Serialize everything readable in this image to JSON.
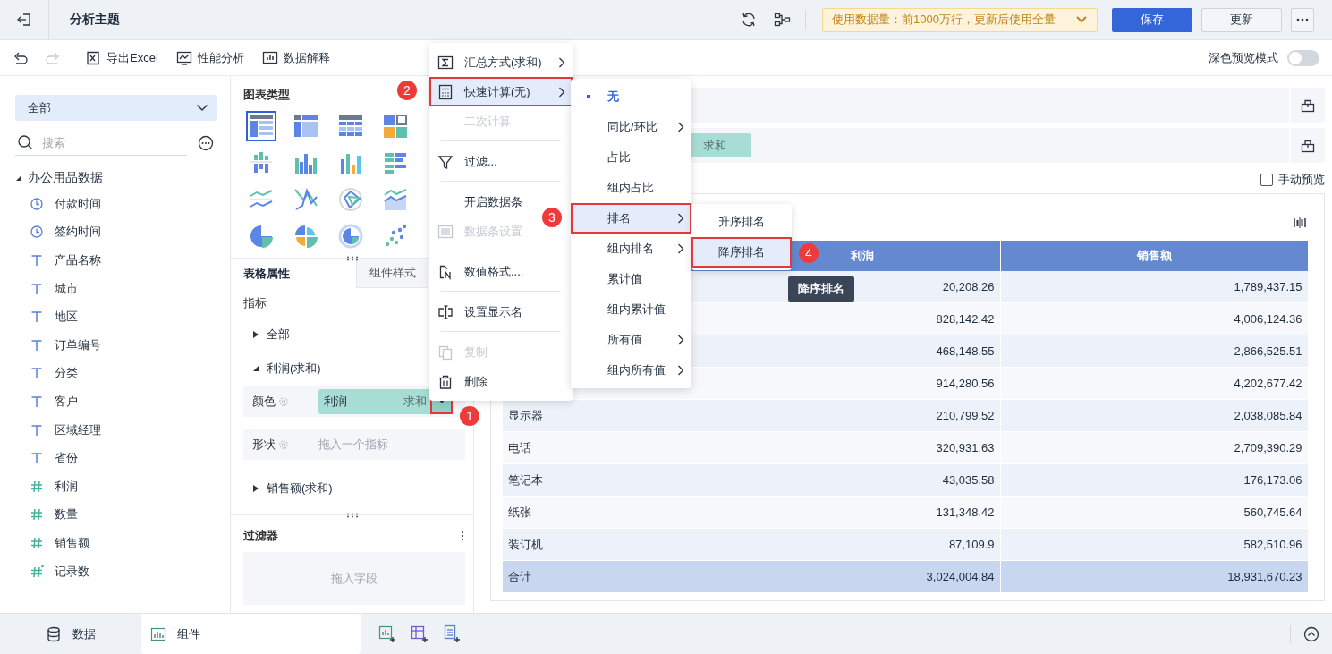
{
  "top_bar": {
    "title": "分析主题",
    "notice": "使用数据量：前1000万行，更新后使用全量",
    "buttons": [
      {
        "label": "保存",
        "kind": "primary"
      },
      {
        "label": "更新",
        "kind": "default"
      }
    ]
  },
  "toolbar": {
    "actions": [
      {
        "label": "导出Excel",
        "kind": "excel"
      },
      {
        "label": "性能分析",
        "kind": "performance"
      },
      {
        "label": "数据解释",
        "kind": "explain"
      }
    ],
    "dark_preview": {
      "label": "深色预览模式",
      "on": false
    }
  },
  "fields_panel": {
    "scope": "全部",
    "search": {
      "placeholder": "搜索"
    },
    "tree": [
      {
        "label": "办公用品数据",
        "expanded": true,
        "children": [
          {
            "label": "付款时间",
            "kind": "date"
          },
          {
            "label": "签约时间",
            "kind": "date"
          },
          {
            "label": "产品名称",
            "kind": "text"
          },
          {
            "label": "城市",
            "kind": "text"
          },
          {
            "label": "地区",
            "kind": "text"
          },
          {
            "label": "订单编号",
            "kind": "text"
          },
          {
            "label": "分类",
            "kind": "text"
          },
          {
            "label": "客户",
            "kind": "text"
          },
          {
            "label": "区域经理",
            "kind": "text"
          },
          {
            "label": "省份",
            "kind": "text"
          },
          {
            "label": "利润",
            "kind": "number"
          },
          {
            "label": "数量",
            "kind": "number"
          },
          {
            "label": "销售额",
            "kind": "number"
          },
          {
            "label": "记录数",
            "kind": "count"
          }
        ]
      }
    ]
  },
  "chart_panel": {
    "title": "图表类型",
    "chart_types": [
      {
        "kind": "table",
        "selected": true
      },
      {
        "kind": "crosstab",
        "selected": false
      },
      {
        "kind": "detail",
        "selected": false
      },
      {
        "kind": "combo",
        "selected": false
      },
      {
        "kind": "stackbar",
        "selected": false
      },
      {
        "kind": "multibar",
        "selected": false
      },
      {
        "kind": "bar",
        "selected": false
      },
      {
        "kind": "hbar",
        "selected": false
      },
      {
        "kind": "line",
        "selected": false
      },
      {
        "kind": "crossline",
        "selected": false
      },
      {
        "kind": "radar",
        "selected": false
      },
      {
        "kind": "area",
        "selected": false
      },
      {
        "kind": "pie",
        "selected": false
      },
      {
        "kind": "rose",
        "selected": false
      },
      {
        "kind": "ring",
        "selected": false
      },
      {
        "kind": "scatter",
        "selected": false
      }
    ]
  },
  "properties": {
    "tabs": [
      {
        "label": "表格属性",
        "selected": true
      },
      {
        "label": "组件样式",
        "selected": false
      }
    ],
    "section": "指标",
    "measures": [
      {
        "label": "全部",
        "expanded": false
      },
      {
        "label": "利润(求和)",
        "expanded": true,
        "slots": [
          {
            "label": "颜色",
            "field": {
              "name": "利润",
              "agg": "求和",
              "marked": true
            }
          },
          {
            "label": "形状",
            "placeholder": "拖入一个指标"
          }
        ]
      },
      {
        "label": "销售额(求和)",
        "expanded": false
      }
    ]
  },
  "filter_panel": {
    "title": "过滤器",
    "placeholder": "拖入字段"
  },
  "canvas": {
    "drop_rows": [
      {
        "kind": "empty"
      },
      {
        "kind": "field",
        "pill": "求和"
      }
    ],
    "manual_preview": {
      "label": "手动预览",
      "checked": false
    }
  },
  "table": {
    "columns": [
      "利润",
      "销售额"
    ],
    "rows": [
      {
        "values": [
          "20,208.26",
          "1,789,437.15"
        ]
      },
      {
        "values": [
          "828,142.42",
          "4,006,124.36"
        ]
      },
      {
        "values": [
          "468,148.55",
          "2,866,525.51"
        ]
      },
      {
        "values": [
          "914,280.56",
          "4,202,677.42"
        ]
      },
      {
        "label": "显示器",
        "values": [
          "210,799.52",
          "2,038,085.84"
        ]
      },
      {
        "label": "电话",
        "values": [
          "320,931.63",
          "2,709,390.29"
        ]
      },
      {
        "label": "笔记本",
        "values": [
          "43,035.58",
          "176,173.06"
        ]
      },
      {
        "label": "纸张",
        "values": [
          "131,348.42",
          "560,745.64"
        ]
      },
      {
        "label": "装订机",
        "values": [
          "87,109.9",
          "582,510.96"
        ]
      }
    ],
    "total": {
      "label": "合计",
      "values": [
        "3,024,004.84",
        "18,931,670.23"
      ]
    }
  },
  "bottom_tabs": [
    {
      "label": "数据",
      "kind": "data",
      "selected": false
    },
    {
      "label": "组件",
      "kind": "component",
      "selected": true
    }
  ],
  "context_menu": [
    {
      "kind": "sigma",
      "label": "汇总方式(求和)",
      "submenu": true,
      "disabled": false,
      "highlighted": false,
      "marked": false
    },
    {
      "kind": "calc",
      "label": "快速计算(无)",
      "submenu": true,
      "disabled": false,
      "highlighted": true,
      "marked": true
    },
    {
      "kind": "plain",
      "label": "二次计算",
      "submenu": false,
      "disabled": true,
      "highlighted": false,
      "marked": false
    },
    {
      "kind": "divider"
    },
    {
      "kind": "filter",
      "label": "过滤...",
      "submenu": false,
      "disabled": false,
      "highlighted": false,
      "marked": false
    },
    {
      "kind": "divider"
    },
    {
      "kind": "plain",
      "label": "开启数据条",
      "submenu": false,
      "disabled": false,
      "highlighted": false,
      "marked": false
    },
    {
      "kind": "databar",
      "label": "数据条设置",
      "submenu": false,
      "disabled": true,
      "highlighted": false,
      "marked": false
    },
    {
      "kind": "divider"
    },
    {
      "kind": "format",
      "label": "数值格式....",
      "submenu": false,
      "disabled": false,
      "highlighted": false,
      "marked": false
    },
    {
      "kind": "divider"
    },
    {
      "kind": "rename",
      "label": "设置显示名",
      "submenu": false,
      "disabled": false,
      "highlighted": false,
      "marked": false
    },
    {
      "kind": "divider"
    },
    {
      "kind": "copy",
      "label": "复制",
      "submenu": false,
      "disabled": true,
      "highlighted": false,
      "marked": false
    },
    {
      "kind": "delete",
      "label": "删除",
      "submenu": false,
      "disabled": false,
      "highlighted": false,
      "marked": false
    }
  ],
  "quick_calc_menu": [
    {
      "label": "无",
      "selected": true,
      "submenu": false,
      "highlighted": false,
      "marked": false
    },
    {
      "label": "同比/环比",
      "selected": false,
      "submenu": true,
      "highlighted": false,
      "marked": false
    },
    {
      "label": "占比",
      "selected": false,
      "submenu": false,
      "highlighted": false,
      "marked": false
    },
    {
      "label": "组内占比",
      "selected": false,
      "submenu": false,
      "highlighted": false,
      "marked": false
    },
    {
      "label": "排名",
      "selected": false,
      "submenu": true,
      "highlighted": true,
      "marked": true
    },
    {
      "label": "组内排名",
      "selected": false,
      "submenu": true,
      "highlighted": false,
      "marked": false
    },
    {
      "label": "累计值",
      "selected": false,
      "submenu": false,
      "highlighted": false,
      "marked": false
    },
    {
      "label": "组内累计值",
      "selected": false,
      "submenu": false,
      "highlighted": false,
      "marked": false
    },
    {
      "label": "所有值",
      "selected": false,
      "submenu": true,
      "highlighted": false,
      "marked": false
    },
    {
      "label": "组内所有值",
      "selected": false,
      "submenu": true,
      "highlighted": false,
      "marked": false
    }
  ],
  "rank_menu": [
    {
      "label": "升序排名",
      "highlighted": false,
      "marked": false
    },
    {
      "label": "降序排名",
      "highlighted": true,
      "marked": true
    }
  ],
  "tooltip": "降序排名",
  "callouts": [
    "1",
    "2",
    "3",
    "4"
  ]
}
